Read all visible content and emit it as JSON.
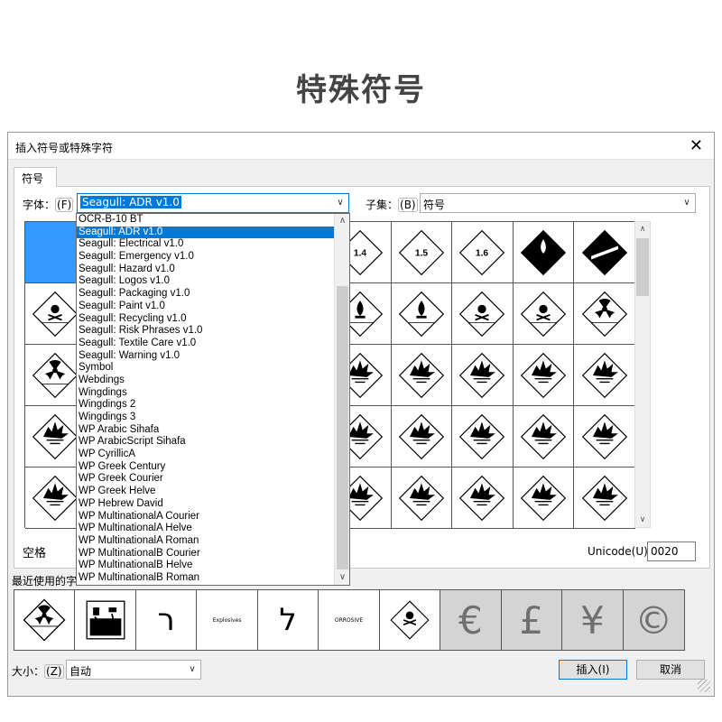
{
  "heading": "特殊符号",
  "dialog": {
    "title": "插入符号或特殊字符",
    "close_symbol": "✕",
    "tab_label": "符号",
    "font_label": "字体：",
    "font_shortcut": "(F)",
    "font_value": "Seagull: ADR v1.0",
    "subset_label": "子集：",
    "subset_shortcut": "(B)",
    "subset_value": "符号",
    "char_name": "空格",
    "unicode_label": "Unicode(U):",
    "unicode_value": "0020",
    "recent_label": "最近使用的字",
    "size_label": "大小：",
    "size_shortcut": "(Z)",
    "size_value": "自动",
    "insert_button": "插入(I)",
    "cancel_button": "取消"
  },
  "font_list": [
    "OCR-B-10 BT",
    "Seagull: ADR v1.0",
    "Seagull: Electrical v1.0",
    "Seagull: Emergency v1.0",
    "Seagull: Hazard v1.0",
    "Seagull: Logos v1.0",
    "Seagull: Packaging v1.0",
    "Seagull: Paint v1.0",
    "Seagull: Recycling v1.0",
    "Seagull: Risk Phrases v1.0",
    "Seagull: Textile Care v1.0",
    "Seagull: Warning v1.0",
    "Symbol",
    "Webdings",
    "Wingdings",
    "Wingdings 2",
    "Wingdings 3",
    "WP Arabic Sihafa",
    "WP ArabicScript Sihafa",
    "WP CyrillicA",
    "WP Greek Century",
    "WP Greek Courier",
    "WP Greek Helve",
    "WP Hebrew David",
    "WP MultinationalA Courier",
    "WP MultinationalA Helve",
    "WP MultinationalA Roman",
    "WP MultinationalB Courier",
    "WP MultinationalB Helve",
    "WP MultinationalB Roman"
  ],
  "selected_font_index": 1,
  "grid_labels": {
    "r0c5": "1.4",
    "r0c6": "1.5",
    "r0c7": "1.6"
  },
  "recent_symbols": {
    "hebrew_resh": "ר",
    "hebrew_lamed": "ל",
    "explosives": "Explosives",
    "corrosive": "ORROSIVE",
    "euro": "€",
    "pound": "£",
    "yen": "¥",
    "copyright": "©"
  },
  "icons": {
    "arrow_down": "∨",
    "arrow_up": "∧"
  }
}
